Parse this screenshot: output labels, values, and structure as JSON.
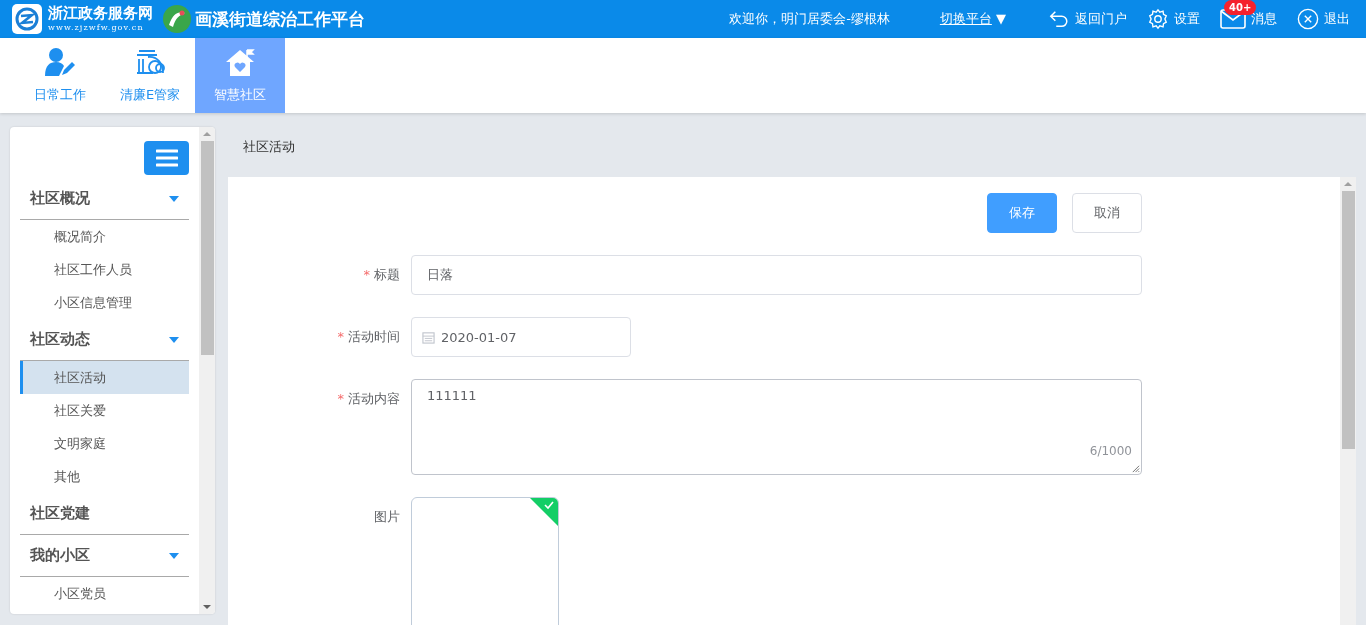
{
  "header": {
    "site_name": "浙江政务服务网",
    "site_url": "www.zjzwfw.gov.cn",
    "platform_title": "画溪街道综治工作平台",
    "welcome": "欢迎你，明门居委会-缪根林",
    "switch_platform": "切换平台",
    "switch_caret": "▼",
    "actions": [
      {
        "kind": "back",
        "label": "返回门户"
      },
      {
        "kind": "settings",
        "label": "设置"
      },
      {
        "kind": "mail",
        "label": "消息",
        "badge": "40+"
      },
      {
        "kind": "logout",
        "label": "退出"
      }
    ]
  },
  "tabs": [
    {
      "kind": "person",
      "label": "日常工作",
      "selected": false
    },
    {
      "kind": "building",
      "label": "清廉E管家",
      "selected": false
    },
    {
      "kind": "house",
      "label": "智慧社区",
      "selected": true
    }
  ],
  "sidebar": {
    "groups": [
      {
        "title": "社区概况",
        "expandable": true,
        "items": [
          {
            "label": "概况简介",
            "selected": false
          },
          {
            "label": "社区工作人员",
            "selected": false
          },
          {
            "label": "小区信息管理",
            "selected": false
          }
        ]
      },
      {
        "title": "社区动态",
        "expandable": true,
        "items": [
          {
            "label": "社区活动",
            "selected": true
          },
          {
            "label": "社区关爱",
            "selected": false
          },
          {
            "label": "文明家庭",
            "selected": false
          },
          {
            "label": "其他",
            "selected": false
          }
        ]
      },
      {
        "title": "社区党建",
        "expandable": false
      },
      {
        "title": "我的小区",
        "expandable": true,
        "items": [
          {
            "label": "小区党员",
            "selected": false
          }
        ]
      }
    ]
  },
  "breadcrumb": "社区活动",
  "buttons": [
    {
      "kind": "primary",
      "label": "保存"
    },
    {
      "kind": "default",
      "label": "取消"
    }
  ],
  "form": [
    {
      "kind": "text",
      "required_mark": "*",
      "label": "标题",
      "value": "日落"
    },
    {
      "kind": "date",
      "required_mark": "*",
      "label": "活动时间",
      "value": "2020-01-07"
    },
    {
      "kind": "textarea",
      "required_mark": "*",
      "label": "活动内容",
      "value": "111111",
      "counter": "6/1000"
    },
    {
      "kind": "image",
      "label": "图片",
      "uploaded": true
    }
  ]
}
